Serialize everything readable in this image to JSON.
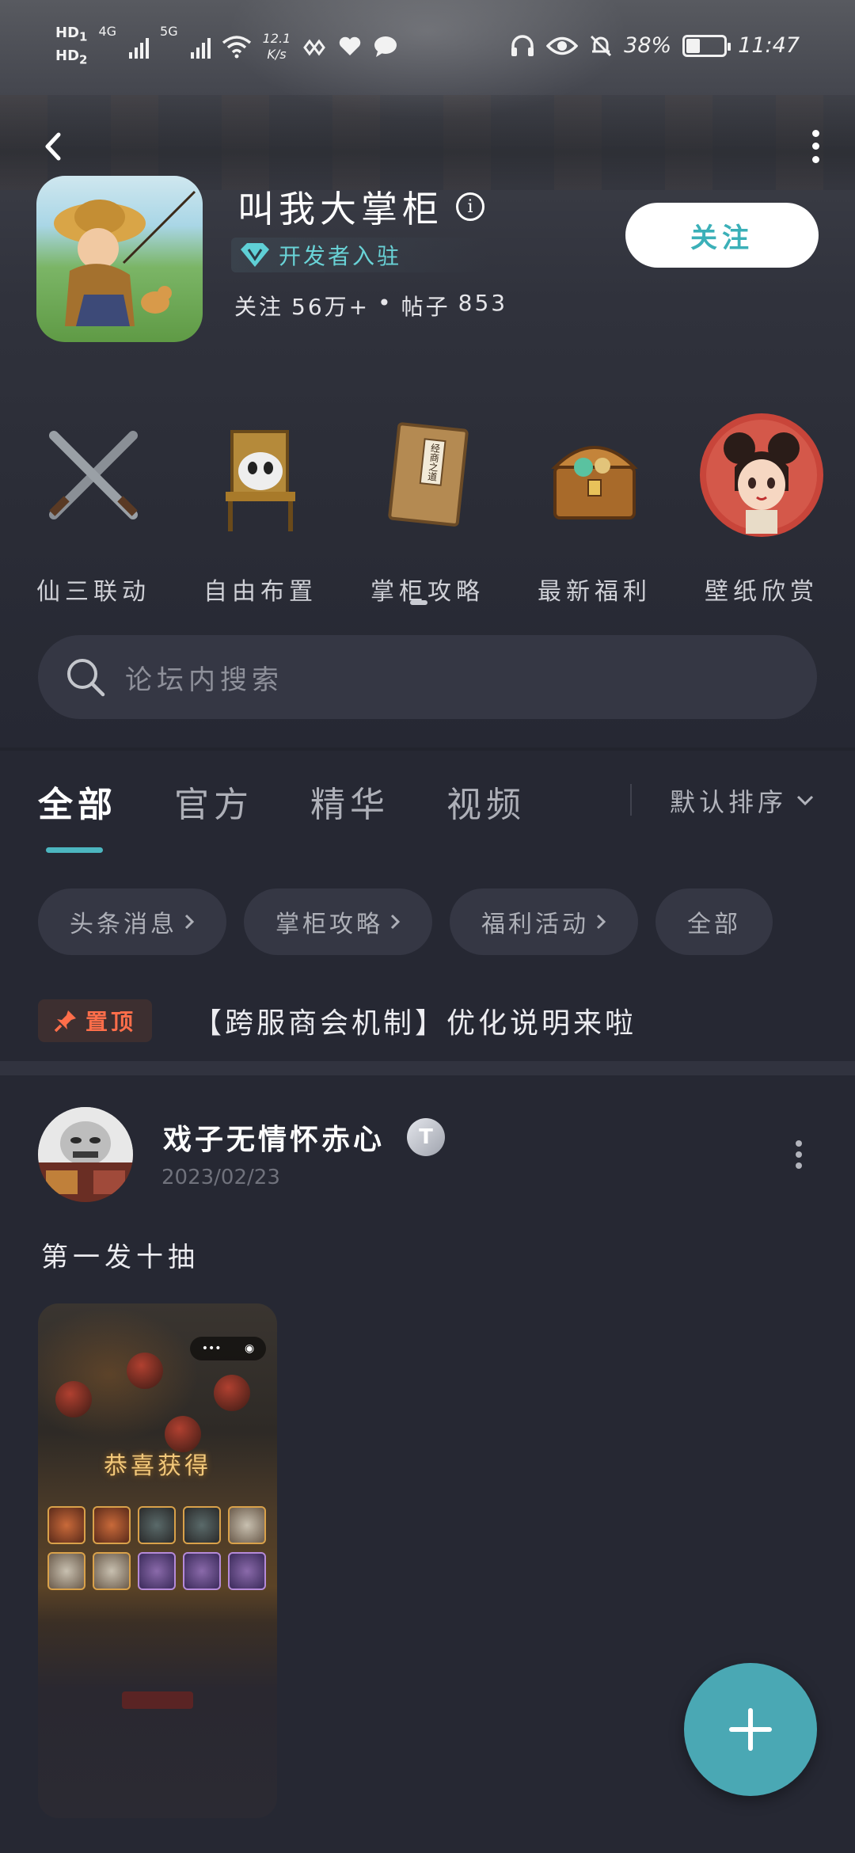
{
  "status_bar": {
    "hd1": "HD",
    "hd2": "HD",
    "sim1_index": "1",
    "sim2_index": "2",
    "net1": "4G",
    "net2": "5G",
    "speed_value": "12.1",
    "speed_unit": "K/s",
    "battery_percent": "38%",
    "battery_level": 0.38,
    "time": "11:47"
  },
  "header": {
    "game_title": "叫我大掌柜",
    "info_icon": "i",
    "dev_badge": "开发者入驻",
    "followers_label": "关注",
    "followers_value": "56万+",
    "stats_sep": "•",
    "posts_label": "帖子",
    "posts_value": "853",
    "follow_button": "关注"
  },
  "entries": [
    {
      "label": "仙三联动",
      "icon": "crossed-swords-icon"
    },
    {
      "label": "自由布置",
      "icon": "chair-icon"
    },
    {
      "label": "掌柜攻略",
      "icon": "book-icon",
      "book_text": "经商之道"
    },
    {
      "label": "最新福利",
      "icon": "treasure-chest-icon"
    },
    {
      "label": "壁纸欣赏",
      "icon": "girl-portrait-icon"
    }
  ],
  "search": {
    "placeholder": "论坛内搜索"
  },
  "tabs": [
    {
      "label": "全部",
      "active": true
    },
    {
      "label": "官方",
      "active": false
    },
    {
      "label": "精华",
      "active": false
    },
    {
      "label": "视频",
      "active": false
    }
  ],
  "sort": {
    "label": "默认排序"
  },
  "chips": [
    {
      "label": "头条消息",
      "arrow": true
    },
    {
      "label": "掌柜攻略",
      "arrow": true
    },
    {
      "label": "福利活动",
      "arrow": true
    },
    {
      "label": "全部",
      "arrow": false
    }
  ],
  "pinned": {
    "tag": "置顶",
    "title": "【跨服商会机制】优化说明来啦"
  },
  "post": {
    "author": "戏子无情怀赤心",
    "level_badge": "T",
    "date": "2023/02/23",
    "text": "第一发十抽",
    "image_caption": "恭喜获得"
  },
  "colors": {
    "accent": "#4aa8b4",
    "follow_text": "#3bb0b8",
    "pin": "#ff6e4a",
    "background": "#262833"
  }
}
